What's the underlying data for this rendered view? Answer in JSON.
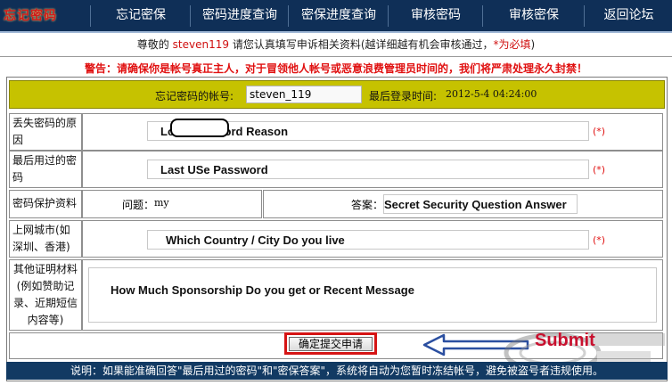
{
  "nav": {
    "logo": "忘记密码",
    "items": [
      "忘记密保",
      "密码进度查询",
      "密保进度查询",
      "审核密码",
      "审核密保",
      "返回论坛"
    ]
  },
  "notice": {
    "prefix": "尊敬的",
    "username": "steven119",
    "middle": " 请您认真填写申诉相关资料(越详细越有机会审核通过，",
    "required": "*为必填",
    "suffix": ")"
  },
  "warning": "警告：请确保你是帐号真正主人，对于冒领他人帐号或恶意浪费管理员时间的，我们将严肃处理永久封禁！",
  "header": {
    "account_label": "忘记密码的帐号:",
    "account_value": "steven_119",
    "last_login_label": "最后登录时间:",
    "last_login_value": "2012-5-4 04:24:00"
  },
  "form": {
    "lost_reason_label": "丢失密码的原因",
    "lost_reason_value": "Lost Password Reason",
    "last_password_label": "最后用过的密码",
    "last_password_value": "Last USe Password",
    "security_label": "密码保护资料",
    "question_label": "问题：",
    "question_value": "my",
    "answer_label": "答案：",
    "answer_value": "Secret Security Question Answer",
    "city_label": "上网城市(如深圳、香港)",
    "city_value": "Which Country / City Do you live",
    "proof_label": "其他证明材料(例如赞助记录、近期短信内容等)",
    "proof_value": "How Much Sponsorship Do you get or Recent Message",
    "required_mark": "(*)"
  },
  "submit": {
    "button_label": "确定提交申请",
    "annotation": "Submit"
  },
  "footer": "说明：如果能准确回答\"最后用过的密码\"和\"密保答案\"，系统将自动为您暂时冻结帐号，避免被盗号者违规使用。",
  "colors": {
    "nav_bg": "#0f2f57",
    "header_bar": "#c6c200",
    "warning_red": "#e01010",
    "annotation_red": "#d51414",
    "arrow_blue": "#2b4fa0"
  }
}
